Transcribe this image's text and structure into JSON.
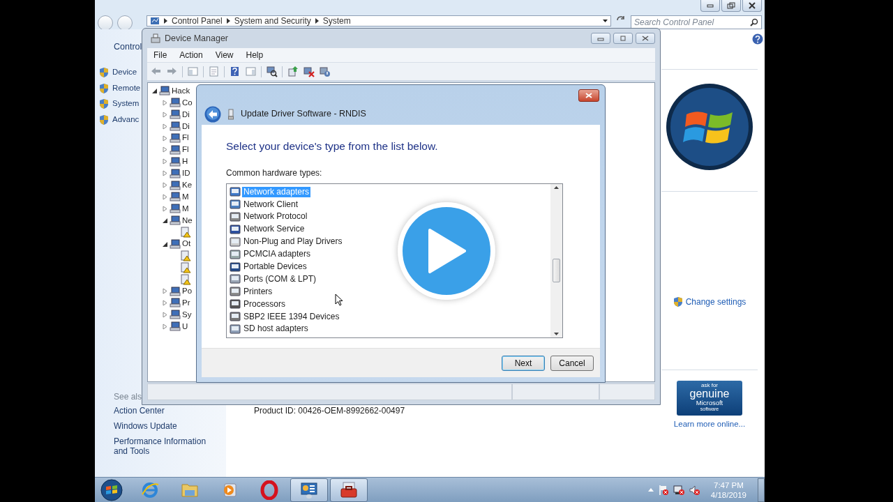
{
  "control_panel": {
    "breadcrumb": [
      "Control Panel",
      "System and Security",
      "System"
    ],
    "search": {
      "placeholder": "Search Control Panel"
    },
    "left_title": "Control",
    "tasks": [
      "Device",
      "Remote",
      "System",
      "Advanc"
    ],
    "see_also_heading": "See als",
    "see_also": [
      "Action Center",
      "Windows Update",
      "Performance Information and Tools"
    ],
    "product_id": "Product ID: 00426-OEM-8992662-00497",
    "change_settings": "Change settings",
    "genuine_badge": {
      "line_1": "ask for",
      "line_2": "genuine",
      "line_3": "Microsoft",
      "line_4": "software"
    },
    "learn_more": "Learn more online..."
  },
  "device_manager": {
    "title": "Device Manager",
    "menu": [
      "File",
      "Action",
      "View",
      "Help"
    ],
    "tree": [
      {
        "kind": "category",
        "label": "Hack",
        "expanded": true,
        "children": [
          {
            "kind": "category",
            "label": "Co",
            "expanded": false
          },
          {
            "kind": "category",
            "label": "Di",
            "expanded": false
          },
          {
            "kind": "category",
            "label": "Di",
            "expanded": false
          },
          {
            "kind": "category",
            "label": "Fl",
            "expanded": false
          },
          {
            "kind": "category",
            "label": "Fl",
            "expanded": false
          },
          {
            "kind": "category",
            "label": "H",
            "expanded": false
          },
          {
            "kind": "category",
            "label": "ID",
            "expanded": false
          },
          {
            "kind": "category",
            "label": "Ke",
            "expanded": false
          },
          {
            "kind": "category",
            "label": "M",
            "expanded": false
          },
          {
            "kind": "category",
            "label": "M",
            "expanded": false
          },
          {
            "kind": "category",
            "label": "Ne",
            "expanded": true,
            "children": [
              {
                "kind": "leaf"
              }
            ]
          },
          {
            "kind": "category",
            "label": "Ot",
            "expanded": true,
            "children": [
              {
                "kind": "leaf"
              },
              {
                "kind": "leaf"
              },
              {
                "kind": "leaf"
              }
            ]
          },
          {
            "kind": "category",
            "label": "Po",
            "expanded": false
          },
          {
            "kind": "category",
            "label": "Pr",
            "expanded": false
          },
          {
            "kind": "category",
            "label": "Sy",
            "expanded": false
          },
          {
            "kind": "category",
            "label": "U",
            "expanded": false
          }
        ]
      }
    ]
  },
  "dialog": {
    "title": "Update Driver Software - RNDIS",
    "heading": "Select your device's type from the list below.",
    "list_label": "Common hardware types:",
    "items": [
      {
        "label": "Network adapters",
        "selected": true
      },
      {
        "label": "Network Client",
        "selected": false
      },
      {
        "label": "Network Protocol",
        "selected": false
      },
      {
        "label": "Network Service",
        "selected": false
      },
      {
        "label": "Non-Plug and Play Drivers",
        "selected": false
      },
      {
        "label": "PCMCIA adapters",
        "selected": false
      },
      {
        "label": "Portable Devices",
        "selected": false
      },
      {
        "label": "Ports (COM & LPT)",
        "selected": false
      },
      {
        "label": "Printers",
        "selected": false
      },
      {
        "label": "Processors",
        "selected": false
      },
      {
        "label": "SBP2 IEEE 1394 Devices",
        "selected": false
      },
      {
        "label": "SD host adapters",
        "selected": false
      }
    ],
    "buttons": [
      {
        "label": "Next",
        "default": true
      },
      {
        "label": "Cancel",
        "default": false
      }
    ]
  },
  "taskbar": {
    "apps": [
      {
        "kind": "browser",
        "open": false
      },
      {
        "kind": "folder",
        "open": false
      },
      {
        "kind": "media",
        "open": false
      },
      {
        "kind": "opera",
        "open": false
      },
      {
        "kind": "control-panel",
        "open": true
      },
      {
        "kind": "toolbox",
        "open": true
      }
    ],
    "clock": {
      "time": "7:47 PM",
      "date": "4/18/2019"
    }
  }
}
